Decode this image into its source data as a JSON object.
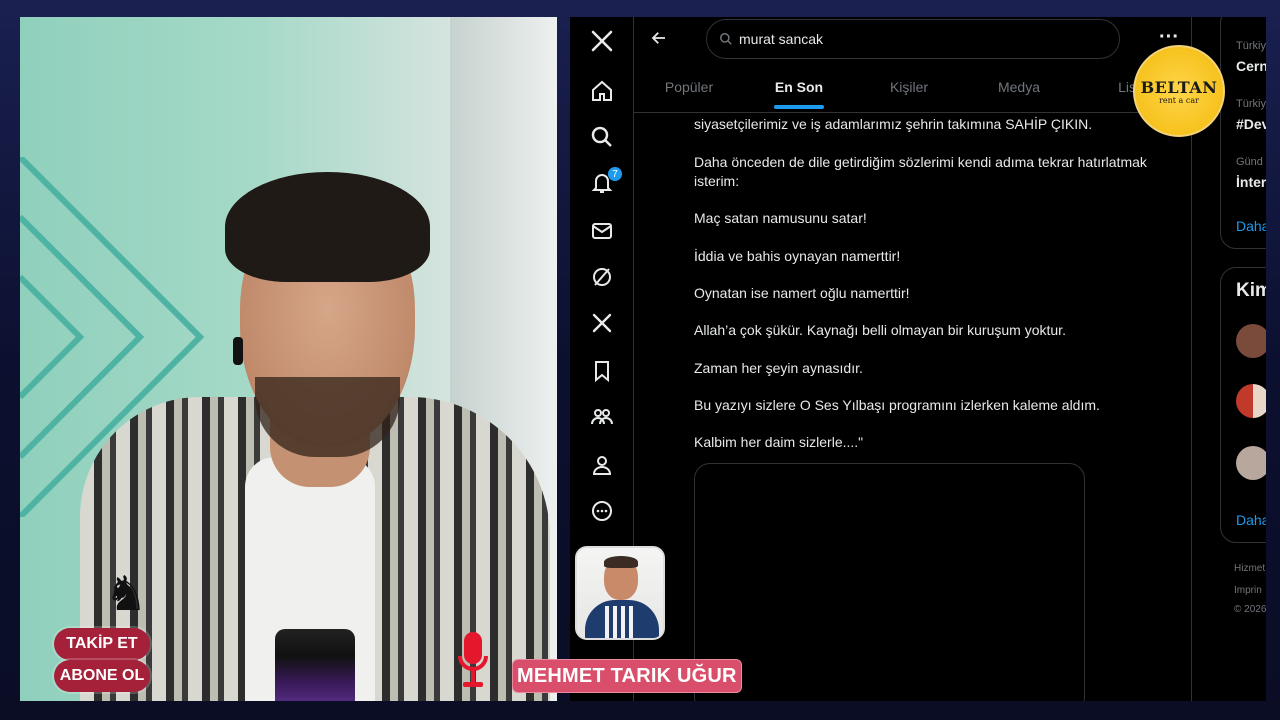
{
  "search": {
    "query": "murat sancak"
  },
  "tabs": [
    {
      "label": "Popüler"
    },
    {
      "label": "En Son"
    },
    {
      "label": "Kişiler"
    },
    {
      "label": "Medya"
    },
    {
      "label": "List"
    }
  ],
  "nav": {
    "notification_count": "7"
  },
  "tweet": {
    "paragraphs": [
      "siyasetçilerimiz ve iş adamlarımız şehrin takımına SAHİP ÇIKIN.",
      "Daha önceden de dile getirdiğim sözlerimi kendi adıma tekrar hatırlatmak isterim:",
      "Maç satan namusunu satar!",
      "İddia ve bahis oynayan namerttir!",
      "Oynatan ise namert oğlu namerttir!",
      "Allah’a çok şükür. Kaynağı belli olmayan bir kuruşum yoktur.",
      "Zaman her şeyin aynasıdır.",
      "Bu yazıyı sizlere O Ses Yılbaşı programını izlerken kaleme aldım.",
      "Kalbim her daim sizlerle....\""
    ]
  },
  "sidebar": {
    "trends": [
      {
        "context": "Türkiy",
        "name": "Cern"
      },
      {
        "context": "Türkiy",
        "name": "#Dev"
      },
      {
        "context": "Günd",
        "name": "İnter"
      }
    ],
    "trends_more": "Daha",
    "who_title": "Kim",
    "who_more": "Daha",
    "footer": [
      "Hizmet",
      "Imprin",
      "© 2026"
    ]
  },
  "overlay": {
    "follow_label": "TAKİP ET",
    "subscribe_label": "ABONE OL",
    "guest_name": "MEHMET TARIK UĞUR",
    "sponsor_name": "BELTAN",
    "sponsor_sub": "rent a car"
  },
  "colors": {
    "accent": "#1d9bf0",
    "overlay_red": "#a5213a",
    "name_tag": "#d94e6a",
    "sponsor": "#f6c21d"
  }
}
